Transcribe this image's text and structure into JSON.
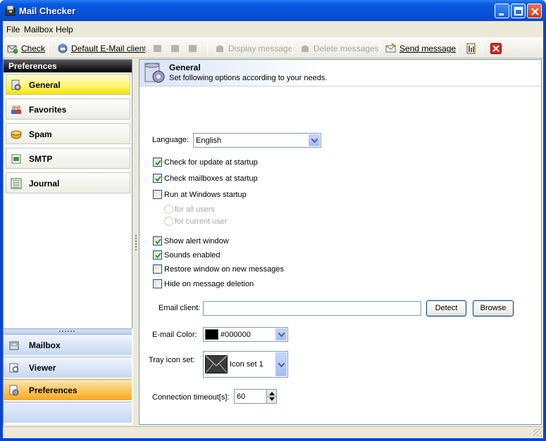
{
  "window": {
    "title": "Mail Checker"
  },
  "menu": [
    "File",
    "Mailbox",
    "Help"
  ],
  "toolbar": {
    "check": "Check",
    "default_client": "Default E-Mail client",
    "display_message": "Display message",
    "delete_messages": "Delete messages",
    "send_message": "Send message"
  },
  "sidebar": {
    "header": "Preferences",
    "items": [
      {
        "label": "General",
        "icon": "gear-icon",
        "active": true
      },
      {
        "label": "Favorites",
        "icon": "people-icon",
        "active": false
      },
      {
        "label": "Spam",
        "icon": "spam-icon",
        "active": false
      },
      {
        "label": "SMTP",
        "icon": "smtp-icon",
        "active": false
      },
      {
        "label": "Journal",
        "icon": "journal-icon",
        "active": false
      }
    ],
    "bottom_nav": [
      {
        "label": "Mailbox",
        "icon": "mailbox-icon",
        "active": false
      },
      {
        "label": "Viewer",
        "icon": "viewer-icon",
        "active": false
      },
      {
        "label": "Preferences",
        "icon": "preferences-icon",
        "active": true
      }
    ]
  },
  "panel": {
    "title": "General",
    "subtitle": "Set following options according to your needs.",
    "language_label": "Language:",
    "language_value": "English",
    "options": [
      {
        "label": "Check for update at startup",
        "checked": true
      },
      {
        "label": "Check mailboxes at startup",
        "checked": true
      },
      {
        "label": "Run at Windows startup",
        "checked": false
      }
    ],
    "radios": [
      {
        "label": "for all users"
      },
      {
        "label": "for current user"
      }
    ],
    "options2": [
      {
        "label": "Show alert window",
        "checked": true
      },
      {
        "label": "Sounds enabled",
        "checked": true
      },
      {
        "label": "Restore window  on new messages",
        "checked": false
      },
      {
        "label": "Hide on message deletion",
        "checked": false
      }
    ],
    "email_client_label": "Email client:",
    "email_client_value": "",
    "detect_button": "Detect",
    "browse_button": "Browse",
    "email_color_label": "E-mail Color:",
    "email_color_value": "#000000",
    "email_color_swatch": "#000000",
    "tray_label": "Tray icon set:",
    "tray_value": "Icon set 1",
    "timeout_label": "Connection timeout[s]:",
    "timeout_value": "60"
  },
  "colors": {
    "active_nav": "#fff470",
    "active_bottom": "#fbc85e",
    "titlebar": "#0552d8"
  }
}
